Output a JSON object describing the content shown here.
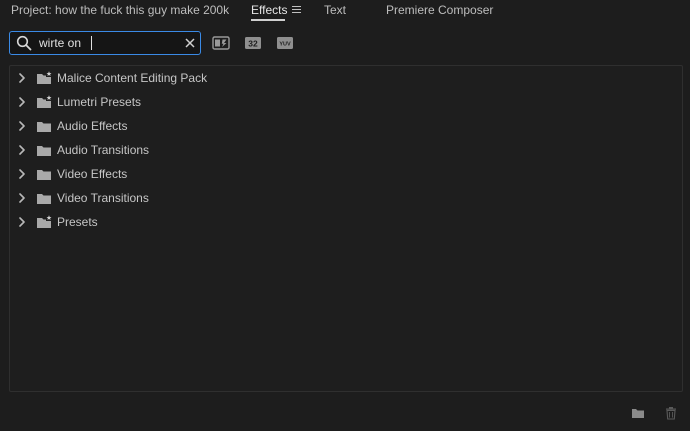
{
  "tabs": {
    "project_label": "Project: how the fuck this guy make 200k",
    "effects_label": "Effects",
    "text_label": "Text",
    "composer_label": "Premiere Composer"
  },
  "search": {
    "value": "wirte on"
  },
  "filters": {
    "accelerated_icon": "accelerated-effects-icon",
    "bit32_text": "32",
    "yuv_text": "YUV"
  },
  "tree": {
    "items": [
      {
        "label": "Malice Content Editing Pack",
        "icon": "preset-folder-icon"
      },
      {
        "label": "Lumetri Presets",
        "icon": "preset-folder-icon"
      },
      {
        "label": "Audio Effects",
        "icon": "folder-icon"
      },
      {
        "label": "Audio Transitions",
        "icon": "folder-icon"
      },
      {
        "label": "Video Effects",
        "icon": "folder-icon"
      },
      {
        "label": "Video Transitions",
        "icon": "folder-icon"
      },
      {
        "label": "Presets",
        "icon": "preset-folder-icon"
      }
    ]
  },
  "colors": {
    "background": "#1d1d1d",
    "focus_accent": "#3a8ae6",
    "text": "#c8c8c8"
  }
}
